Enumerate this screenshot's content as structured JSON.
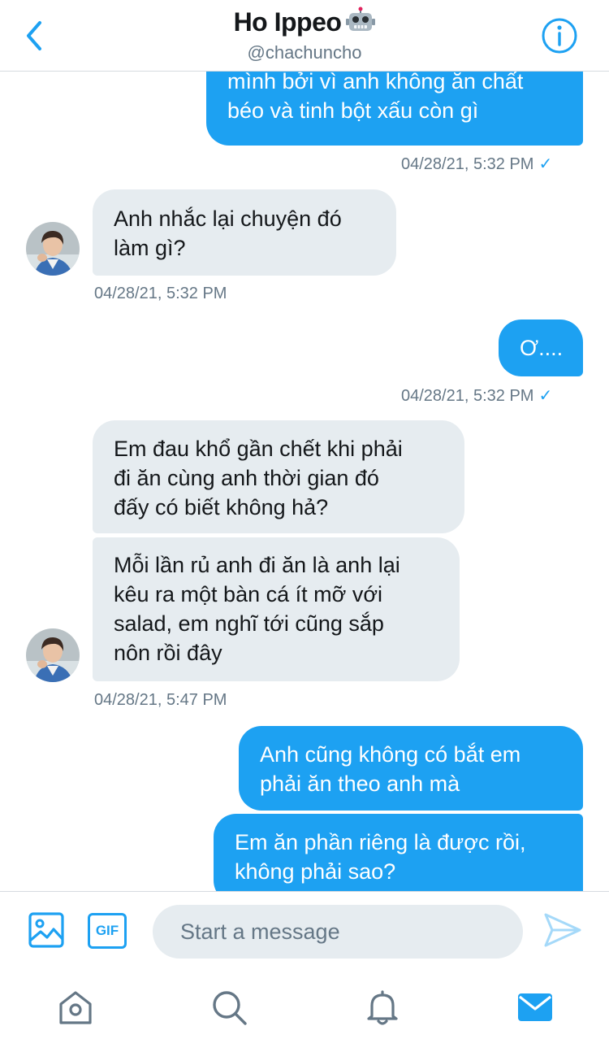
{
  "header": {
    "title": "Ho Ippeo",
    "handle": "@chachuncho"
  },
  "messages": [
    {
      "direction": "out",
      "text": [
        "mình bởi vì anh không ăn chất",
        "béo và tinh bột xấu còn gì"
      ]
    },
    {
      "direction": "timestamp-out",
      "text": "04/28/21, 5:32 PM"
    },
    {
      "direction": "in",
      "text": [
        "Anh nhắc lại chuyện đó",
        "làm gì?"
      ]
    },
    {
      "direction": "timestamp-in",
      "text": "04/28/21, 5:32 PM"
    },
    {
      "direction": "out",
      "text": [
        "Ơ...."
      ]
    },
    {
      "direction": "timestamp-out",
      "text": "04/28/21, 5:32 PM"
    },
    {
      "direction": "in",
      "text": [
        "Em đau khổ gần chết khi phải",
        "đi ăn cùng anh thời gian đó",
        "đấy có biết không hả?"
      ]
    },
    {
      "direction": "in",
      "text": [
        "Mỗi lần rủ anh đi ăn là anh lại",
        "kêu ra một bàn cá ít mỡ với",
        "salad, em nghĩ tới cũng sắp",
        "nôn rồi đây"
      ]
    },
    {
      "direction": "timestamp-in",
      "text": "04/28/21, 5:47 PM"
    },
    {
      "direction": "out",
      "text": [
        "Anh cũng không có bắt em",
        "phải ăn theo anh mà"
      ]
    },
    {
      "direction": "out",
      "text": [
        "Em ăn phần riêng là được rồi,",
        "không phải sao?"
      ]
    }
  ],
  "read_check": "✓",
  "composer": {
    "placeholder": "Start a message",
    "gif_label": "GIF"
  },
  "icons": {
    "back": "chevron-left-icon",
    "info": "info-icon",
    "robot": "robot-emoji-icon",
    "image": "image-icon",
    "send": "send-icon",
    "home": "home-icon",
    "search": "search-icon",
    "notifications": "bell-icon",
    "messages": "mail-icon"
  },
  "colors": {
    "accent": "#1da1f2",
    "incoming_bubble": "#e6ecf0",
    "secondary_text": "#657786",
    "tab_icon": "#657786"
  }
}
